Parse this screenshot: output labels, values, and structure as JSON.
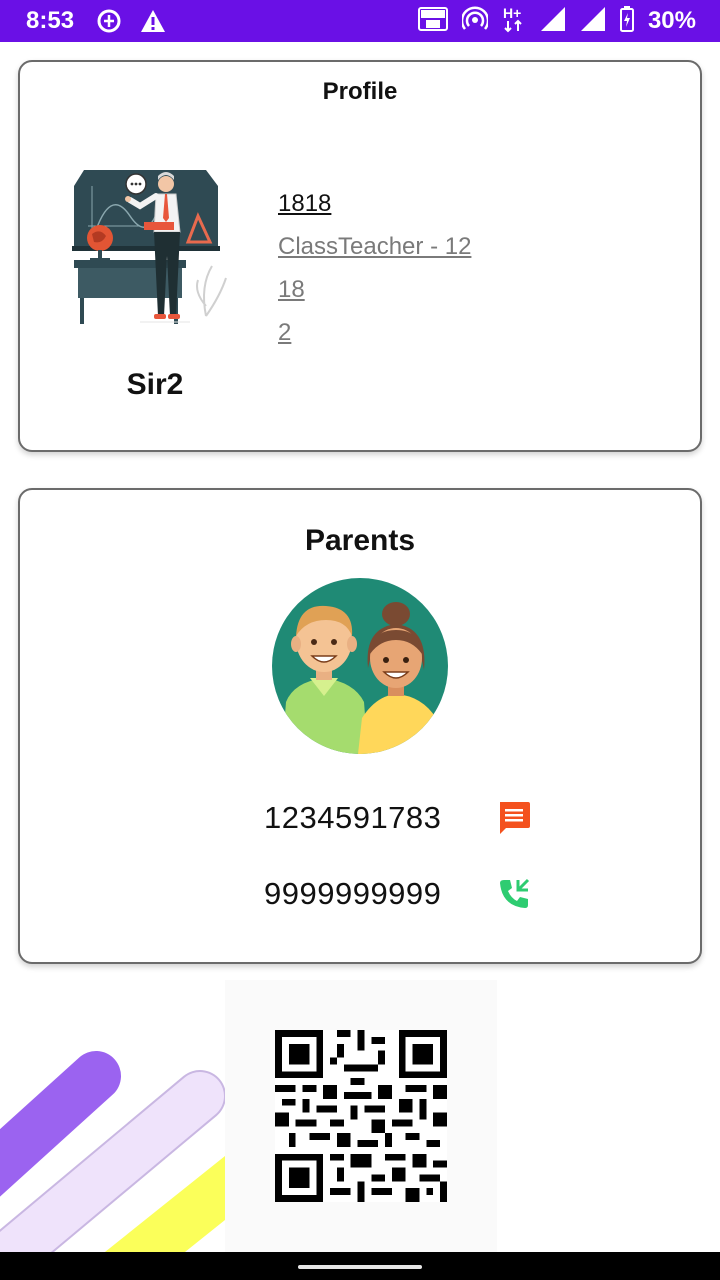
{
  "status_bar": {
    "time": "8:53",
    "battery": "30%",
    "icons": [
      "data-saver-icon",
      "warning-icon",
      "volte-icon",
      "hotspot-icon",
      "hplus-icon",
      "signal-icon",
      "signal-icon",
      "battery-icon"
    ],
    "colors": {
      "background": "#6a10e6"
    }
  },
  "profile": {
    "title": "Profile",
    "name": "Sir2",
    "info": [
      "1818",
      "ClassTeacher - 12",
      "18",
      "2"
    ],
    "illustration": "teacher-illustration"
  },
  "parents": {
    "title": "Parents",
    "illustration": "parents-avatar",
    "phones": [
      {
        "number": "1234591783",
        "action_icon": "message-icon",
        "color": "#f4511e"
      },
      {
        "number": "9999999999",
        "action_icon": "call-icon",
        "color": "#2ecc71"
      }
    ]
  },
  "bottom": {
    "qr_code": "qr-code",
    "stripe_colors": [
      "#9b63f0",
      "#efe3fb",
      "#fbff5a"
    ]
  }
}
